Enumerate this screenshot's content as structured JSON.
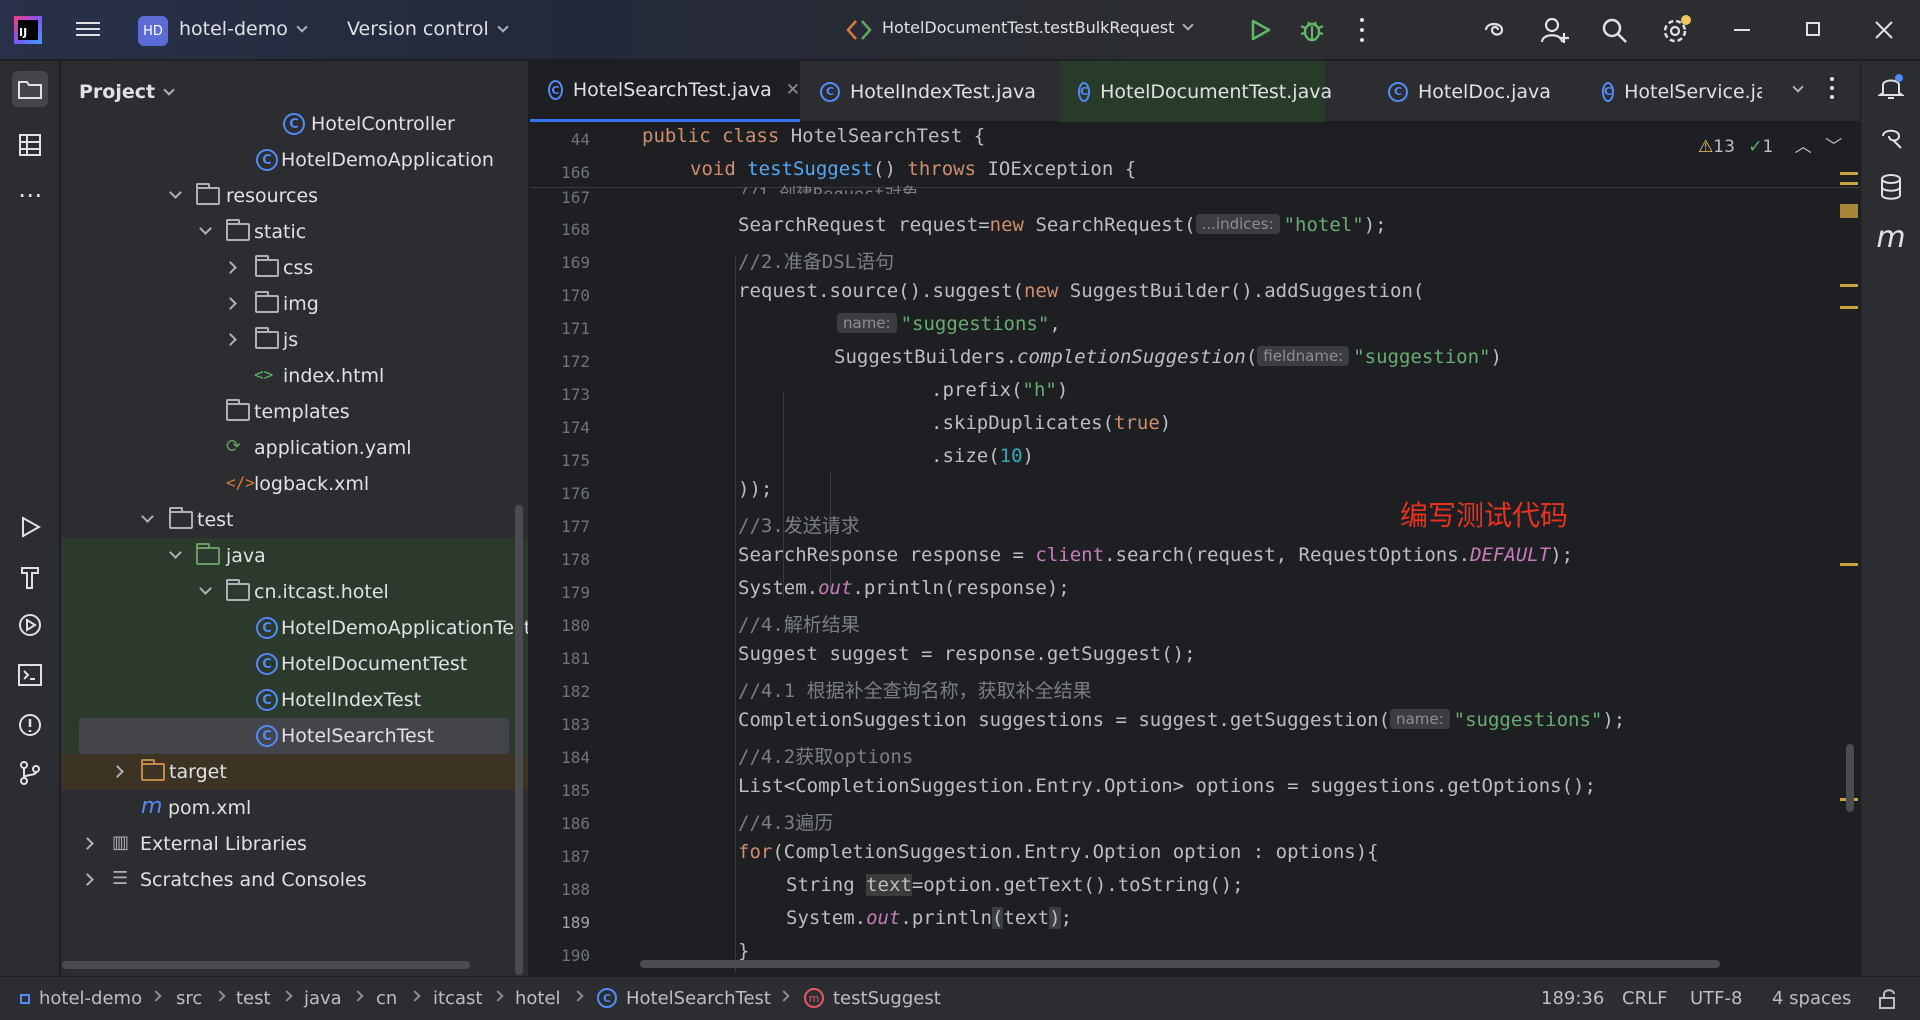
{
  "titlebar": {
    "project_badge": "HD",
    "project_name": "hotel-demo",
    "vcs_label": "Version control",
    "run_config": "HotelDocumentTest.testBulkRequest"
  },
  "project_panel": {
    "title": "Project",
    "rows": [
      {
        "label": "HotelController",
        "icon": "class-icon"
      },
      {
        "label": "HotelDemoApplication",
        "icon": "spring-class-icon"
      },
      {
        "label": "resources",
        "icon": "folder-icon"
      },
      {
        "label": "static",
        "icon": "folder-icon"
      },
      {
        "label": "css",
        "icon": "folder-icon"
      },
      {
        "label": "img",
        "icon": "folder-icon"
      },
      {
        "label": "js",
        "icon": "folder-icon"
      },
      {
        "label": "index.html",
        "icon": "html-icon"
      },
      {
        "label": "templates",
        "icon": "folder-icon"
      },
      {
        "label": "application.yaml",
        "icon": "yaml-icon"
      },
      {
        "label": "logback.xml",
        "icon": "xml-icon"
      },
      {
        "label": "test",
        "icon": "folder-icon"
      },
      {
        "label": "java",
        "icon": "folder-icon"
      },
      {
        "label": "cn.itcast.hotel",
        "icon": "package-icon"
      },
      {
        "label": "HotelDemoApplicationTests",
        "icon": "test-class-icon"
      },
      {
        "label": "HotelDocumentTest",
        "icon": "test-class-icon"
      },
      {
        "label": "HotelIndexTest",
        "icon": "test-class-icon"
      },
      {
        "label": "HotelSearchTest",
        "icon": "test-class-icon"
      },
      {
        "label": "target",
        "icon": "folder-icon"
      },
      {
        "label": "pom.xml",
        "icon": "maven-icon"
      },
      {
        "label": "External Libraries",
        "icon": "library-icon"
      },
      {
        "label": "Scratches and Consoles",
        "icon": "scratch-icon"
      }
    ]
  },
  "tabs": [
    {
      "label": "HotelSearchTest.java"
    },
    {
      "label": "HotelIndexTest.java"
    },
    {
      "label": "HotelDocumentTest.java"
    },
    {
      "label": "HotelDoc.java"
    },
    {
      "label": "HotelService.ja"
    }
  ],
  "editor": {
    "warnings": "13",
    "checks": "1",
    "annotation": "编写测试代码",
    "sticky": [
      {
        "no": "44",
        "text": "public class HotelSearchTest {"
      },
      {
        "no": "166",
        "text": "void testSuggest() throws IOException {"
      }
    ],
    "line_numbers": [
      "167",
      "168",
      "169",
      "170",
      "171",
      "172",
      "173",
      "174",
      "175",
      "176",
      "177",
      "178",
      "179",
      "180",
      "181",
      "182",
      "183",
      "184",
      "185",
      "186",
      "187",
      "188",
      "189",
      "190"
    ],
    "hints": {
      "indices": "...indices:",
      "name": "name:",
      "fieldname": "fieldname:"
    }
  },
  "statusbar": {
    "crumbs": [
      "hotel-demo",
      "src",
      "test",
      "java",
      "cn",
      "itcast",
      "hotel",
      "HotelSearchTest",
      "testSuggest"
    ],
    "position": "189:36",
    "line_sep": "CRLF",
    "encoding": "UTF-8",
    "indent": "4 spaces"
  }
}
